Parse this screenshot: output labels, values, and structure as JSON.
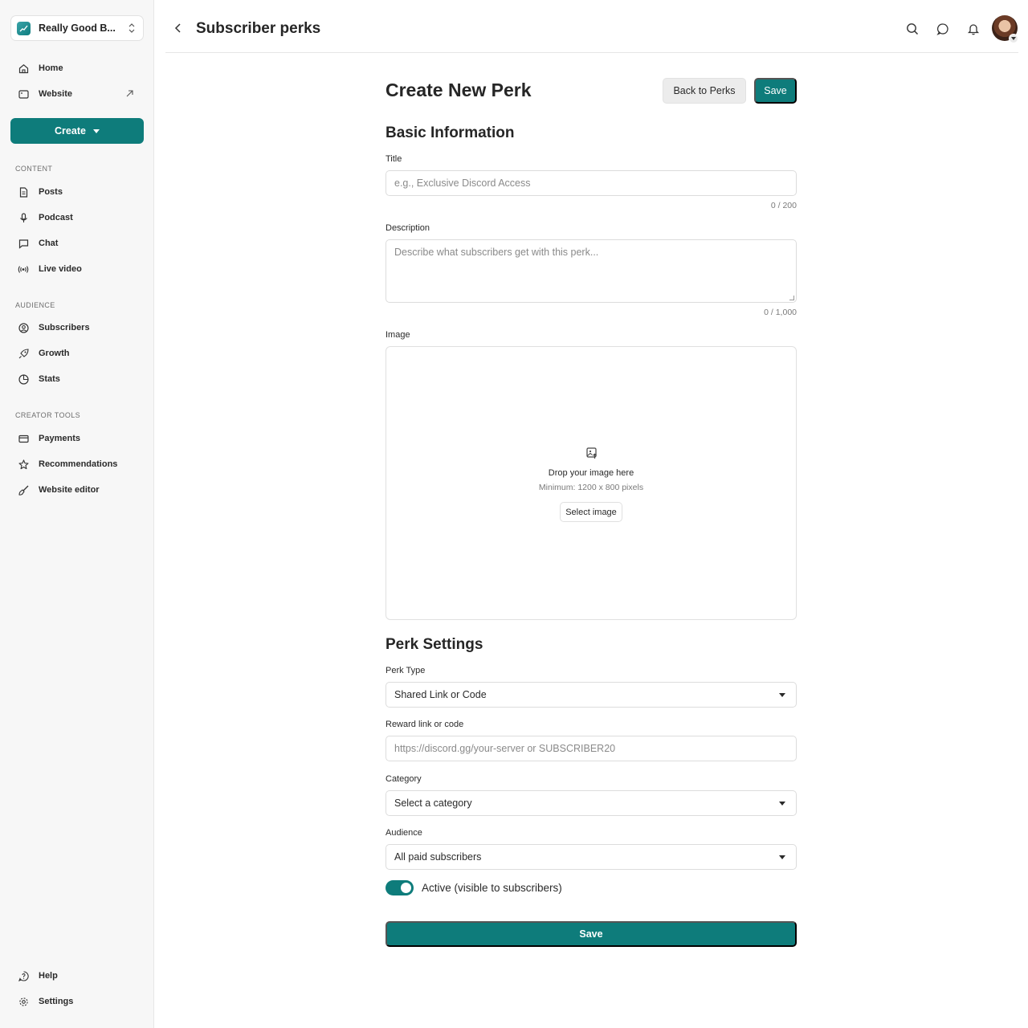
{
  "sidebar": {
    "publication_name": "Really Good B...",
    "nav_top": [
      {
        "label": "Home",
        "icon": "home-icon"
      },
      {
        "label": "Website",
        "icon": "browser-icon"
      }
    ],
    "create_label": "Create",
    "sections": [
      {
        "label": "CONTENT",
        "items": [
          {
            "label": "Posts",
            "icon": "document-icon"
          },
          {
            "label": "Podcast",
            "icon": "microphone-icon"
          },
          {
            "label": "Chat",
            "icon": "chat-icon"
          },
          {
            "label": "Live video",
            "icon": "broadcast-icon"
          }
        ]
      },
      {
        "label": "AUDIENCE",
        "items": [
          {
            "label": "Subscribers",
            "icon": "user-circle-icon"
          },
          {
            "label": "Growth",
            "icon": "rocket-icon"
          },
          {
            "label": "Stats",
            "icon": "pie-chart-icon"
          }
        ]
      },
      {
        "label": "CREATOR TOOLS",
        "items": [
          {
            "label": "Payments",
            "icon": "credit-card-icon"
          },
          {
            "label": "Recommendations",
            "icon": "star-icon"
          },
          {
            "label": "Website editor",
            "icon": "brush-icon"
          }
        ]
      }
    ],
    "nav_bottom": [
      {
        "label": "Help",
        "icon": "help-icon"
      },
      {
        "label": "Settings",
        "icon": "gear-icon"
      }
    ]
  },
  "header": {
    "title": "Subscriber perks"
  },
  "form": {
    "heading": "Create New Perk",
    "back_label": "Back to Perks",
    "save_label": "Save",
    "basic_heading": "Basic Information",
    "title_label": "Title",
    "title_placeholder": "e.g., Exclusive Discord Access",
    "title_counter": "0 / 200",
    "description_label": "Description",
    "description_placeholder": "Describe what subscribers get with this perk...",
    "description_counter": "0 / 1,000",
    "image_label": "Image",
    "drop_title": "Drop your image here",
    "drop_sub": "Minimum: 1200 x 800 pixels",
    "select_image_label": "Select image",
    "settings_heading": "Perk Settings",
    "perk_type_label": "Perk Type",
    "perk_type_value": "Shared Link or Code",
    "reward_label": "Reward link or code",
    "reward_placeholder": "https://discord.gg/your-server or SUBSCRIBER20",
    "category_label": "Category",
    "category_value": "Select a category",
    "audience_label": "Audience",
    "audience_value": "All paid subscribers",
    "active_label": "Active (visible to subscribers)",
    "active_on": true,
    "save_bottom_label": "Save"
  },
  "colors": {
    "accent": "#0e7c7b"
  }
}
